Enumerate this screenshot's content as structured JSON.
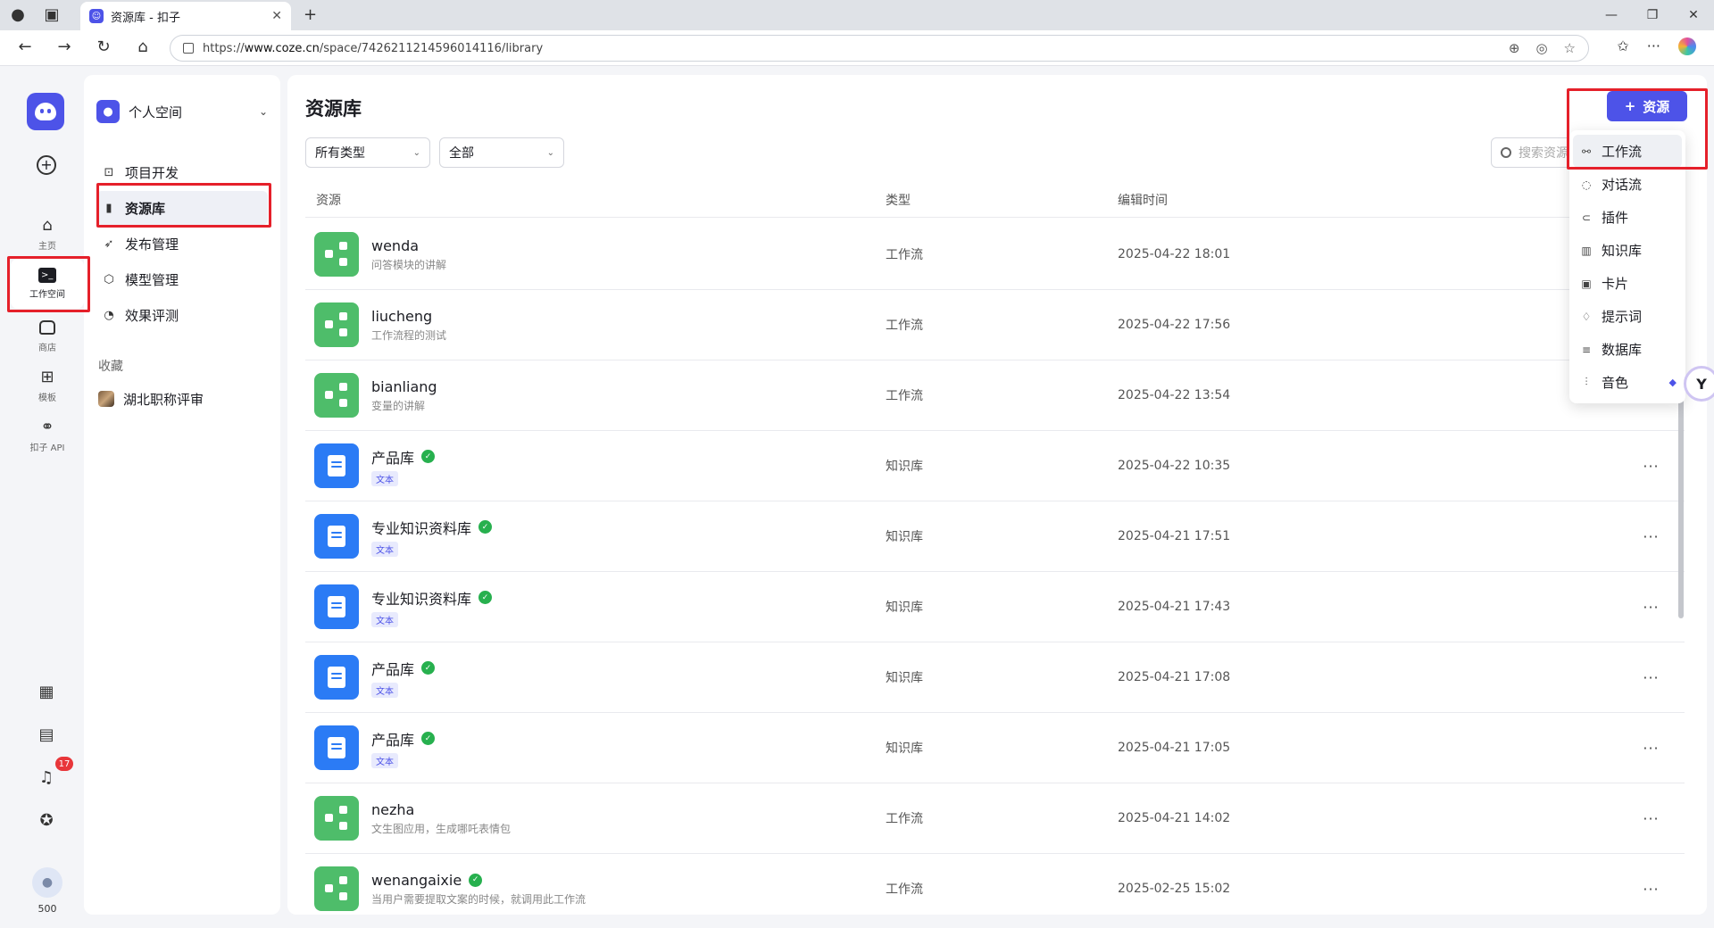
{
  "browser": {
    "tab_title": "资源库 - 扣子",
    "url_prefix": "https://",
    "url_host": "www.coze.cn",
    "url_path": "/space/7426211214596014116/library"
  },
  "rail": {
    "items": [
      {
        "label": "主页"
      },
      {
        "label": "工作空间"
      },
      {
        "label": "商店"
      },
      {
        "label": "模板"
      },
      {
        "label": "扣子 API"
      }
    ],
    "notification_count": "17",
    "credits": "500"
  },
  "sidebar": {
    "space_name": "个人空间",
    "menu": [
      {
        "label": "项目开发"
      },
      {
        "label": "资源库"
      },
      {
        "label": "发布管理"
      },
      {
        "label": "模型管理"
      },
      {
        "label": "效果评测"
      }
    ],
    "favorites_title": "收藏",
    "favorites": [
      {
        "label": "湖北职称评审"
      }
    ]
  },
  "main": {
    "title": "资源库",
    "filter_type": "所有类型",
    "filter_scope": "全部",
    "search_placeholder": "搜索资源",
    "add_button": "资源",
    "columns": {
      "resource": "资源",
      "type": "类型",
      "time": "编辑时间"
    },
    "rows": [
      {
        "name": "wenda",
        "desc": "问答模块的讲解",
        "type": "工作流",
        "time": "2025-04-22 18:01",
        "kind": "workflow",
        "verified": false,
        "more": ""
      },
      {
        "name": "liucheng",
        "desc": "工作流程的测试",
        "type": "工作流",
        "time": "2025-04-22 17:56",
        "kind": "workflow",
        "verified": false,
        "more": ""
      },
      {
        "name": "bianliang",
        "desc": "变量的讲解",
        "type": "工作流",
        "time": "2025-04-22 13:54",
        "kind": "workflow",
        "verified": false,
        "more": ""
      },
      {
        "name": "产品库",
        "tag": "文本",
        "type": "知识库",
        "time": "2025-04-22 10:35",
        "kind": "knowledge",
        "verified": true,
        "more": "···"
      },
      {
        "name": "专业知识资料库",
        "tag": "文本",
        "type": "知识库",
        "time": "2025-04-21 17:51",
        "kind": "knowledge",
        "verified": true,
        "more": "···"
      },
      {
        "name": "专业知识资料库",
        "tag": "文本",
        "type": "知识库",
        "time": "2025-04-21 17:43",
        "kind": "knowledge",
        "verified": true,
        "more": "···"
      },
      {
        "name": "产品库",
        "tag": "文本",
        "type": "知识库",
        "time": "2025-04-21 17:08",
        "kind": "knowledge",
        "verified": true,
        "more": "···"
      },
      {
        "name": "产品库",
        "tag": "文本",
        "type": "知识库",
        "time": "2025-04-21 17:05",
        "kind": "knowledge",
        "verified": true,
        "more": "···"
      },
      {
        "name": "nezha",
        "desc": "文生图应用，生成哪吒表情包",
        "type": "工作流",
        "time": "2025-04-21 14:02",
        "kind": "workflow",
        "verified": false,
        "more": "···"
      },
      {
        "name": "wenangaixie",
        "desc": "当用户需要提取文案的时候，就调用此工作流",
        "type": "工作流",
        "time": "2025-02-25 15:02",
        "kind": "workflow",
        "verified": true,
        "more": "···"
      }
    ]
  },
  "dropdown": {
    "items": [
      {
        "label": "工作流",
        "icon": "workflow-icon"
      },
      {
        "label": "对话流",
        "icon": "chatflow-icon"
      },
      {
        "label": "插件",
        "icon": "plugin-icon"
      },
      {
        "label": "知识库",
        "icon": "knowledge-icon"
      },
      {
        "label": "卡片",
        "icon": "card-icon"
      },
      {
        "label": "提示词",
        "icon": "prompt-icon"
      },
      {
        "label": "数据库",
        "icon": "database-icon"
      },
      {
        "label": "音色",
        "icon": "voice-icon"
      }
    ]
  },
  "colors": {
    "brand": "#4d53e8",
    "workflow": "#4ebd6a",
    "knowledge": "#2b7bf5",
    "annotation": "#e5202a"
  }
}
